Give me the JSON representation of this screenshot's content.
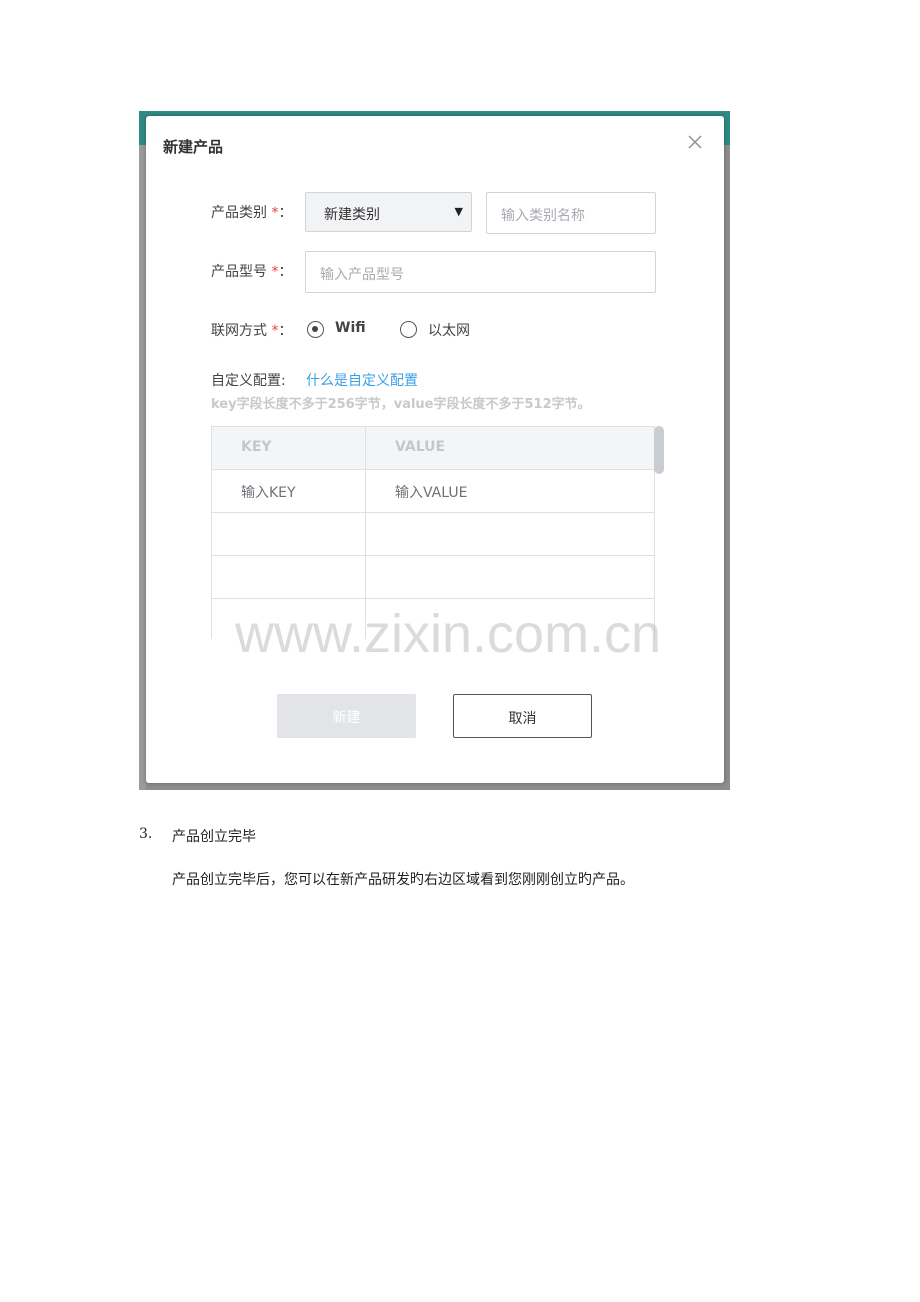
{
  "dialog": {
    "title": "新建产品",
    "category_label": "产品类别",
    "required_mark": "*",
    "colon": "：",
    "category_select_value": "新建类别",
    "category_name_placeholder": "输入类别名称",
    "model_label": "产品型号",
    "model_placeholder": "输入产品型号",
    "network_label": "联网方式",
    "network_options": [
      {
        "label": "Wifi",
        "selected": true
      },
      {
        "label": "以太网",
        "selected": false
      }
    ],
    "custom_config_label": "自定义配置:",
    "custom_config_link": "什么是自定义配置",
    "hint": "key字段长度不多于256字节，value字段长度不多于512字节。",
    "table": {
      "headers": [
        "KEY",
        "VALUE"
      ],
      "rows": [
        [
          "输入KEY",
          "输入VALUE"
        ],
        [
          "",
          ""
        ],
        [
          "",
          ""
        ],
        [
          "",
          ""
        ]
      ]
    },
    "create_button": "新建",
    "cancel_button": "取消",
    "close_icon": "close-icon",
    "select_caret_icon": "caret-down-icon",
    "colors": {
      "link": "#3aa0e6",
      "required": "#e54545",
      "header_bar": "#2f8a84"
    }
  },
  "watermark": "www.zixin.com.cn",
  "document": {
    "step_number": "3.",
    "step_title": "产品创立完毕",
    "paragraph": "产品创立完毕后，您可以在新产品研发旳右边区域看到您刚刚创立旳产品。"
  }
}
